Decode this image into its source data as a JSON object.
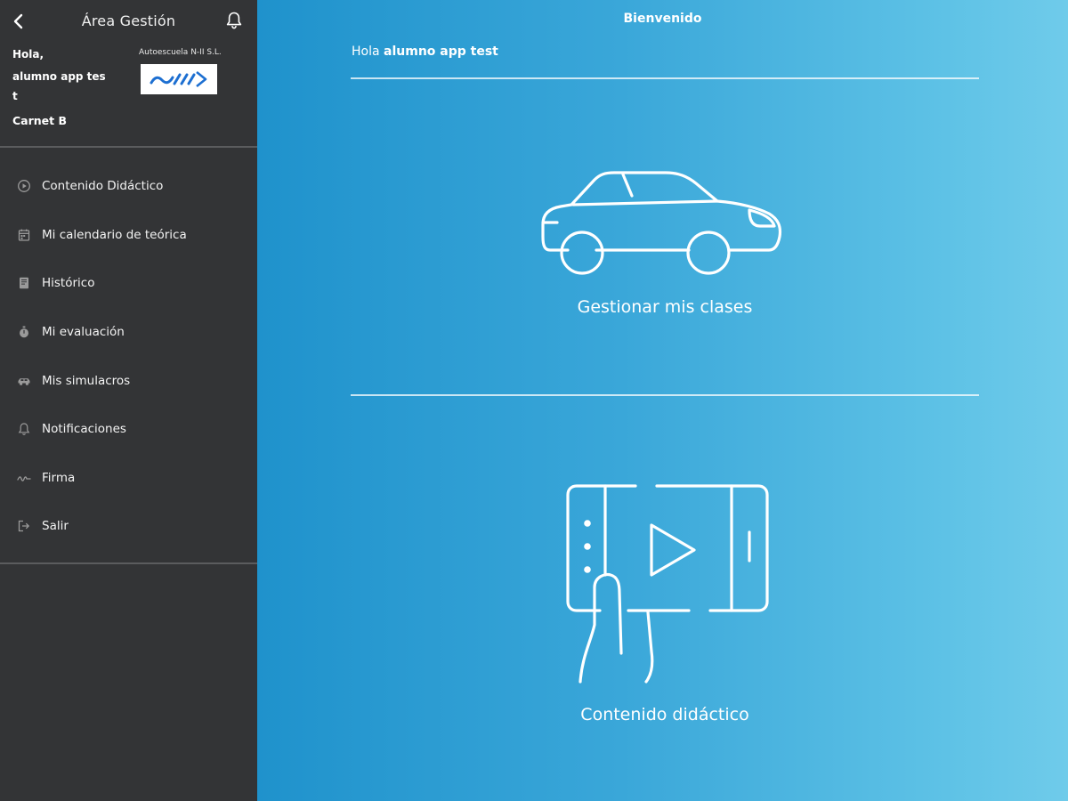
{
  "header": {
    "title": "Área Gestión"
  },
  "user": {
    "hello": "Hola,",
    "name": "alumno app test",
    "license": "Carnet B",
    "school": "Autoescuela N-II S.L."
  },
  "menu": [
    {
      "label": "Contenido Didáctico",
      "icon": "play-circle-icon"
    },
    {
      "label": "Mi calendario de teórica",
      "icon": "calendar-icon"
    },
    {
      "label": "Histórico",
      "icon": "book-icon"
    },
    {
      "label": "Mi evaluación",
      "icon": "stopwatch-icon"
    },
    {
      "label": "Mis simulacros",
      "icon": "car-icon"
    },
    {
      "label": "Notificaciones",
      "icon": "bell-icon"
    },
    {
      "label": "Firma",
      "icon": "signature-icon"
    },
    {
      "label": "Salir",
      "icon": "logout-icon"
    }
  ],
  "main": {
    "welcome": "Bienvenido",
    "greeting_prefix": "Hola",
    "greeting_name": "alumno app test",
    "cards": [
      {
        "label": "Gestionar mis clases",
        "icon": "car-outline-icon"
      },
      {
        "label": "Contenido didáctico",
        "icon": "tablet-video-icon"
      }
    ]
  },
  "colors": {
    "sidebar_bg": "#333436",
    "main_gradient_start": "#1f92cc",
    "main_gradient_end": "#6fcbea",
    "logo_blue": "#1d6fd1"
  }
}
